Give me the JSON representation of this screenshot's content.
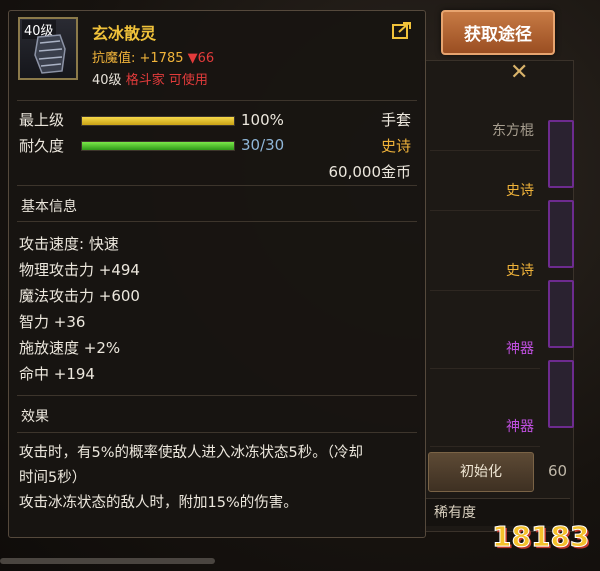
{
  "item": {
    "level_badge": "40级",
    "name": "玄冰散灵",
    "resist_label": "抗魔值: +1785",
    "resist_change": "▼66",
    "req_level": "40级",
    "req_class": "格斗家",
    "req_status": "可使用"
  },
  "stats": {
    "max_level_label": "最上级",
    "max_level_value": "100%",
    "max_level_fraction": 1.0,
    "durability_label": "耐久度",
    "durability_value": "30/30",
    "durability_fraction": 1.0,
    "slot": "手套",
    "rarity": "史诗",
    "price": "60,000金币"
  },
  "basic_info": {
    "title": "基本信息",
    "attributes": [
      "攻击速度: 快速",
      "物理攻击力 +494",
      "魔法攻击力 +600",
      "智力 +36",
      "施放速度 +2%",
      "命中 +194"
    ]
  },
  "effect": {
    "title": "效果",
    "lines": [
      "攻击时，有5%的概率使敌人进入冰冻状态5秒。（冷却",
      "时间5秒）",
      "攻击冰冻状态的敌人时，附加15%的伤害。"
    ]
  },
  "acquire_button": "获取途径",
  "background": {
    "rows": [
      "东方棍",
      "史诗",
      "史诗",
      "神器",
      "神器"
    ],
    "reset_button": "初始化",
    "rarity_filter": "稀有度",
    "number": "60"
  },
  "watermark": "18183",
  "colors": {
    "gold": "#f0c23a",
    "epic": "#f0b33a",
    "warn_red": "#e23b3b",
    "bar_yellow": "#e8c21f",
    "bar_green": "#4fcf2a",
    "durability_text": "#8fb6d8",
    "artifact_purple": "#c050e0"
  }
}
